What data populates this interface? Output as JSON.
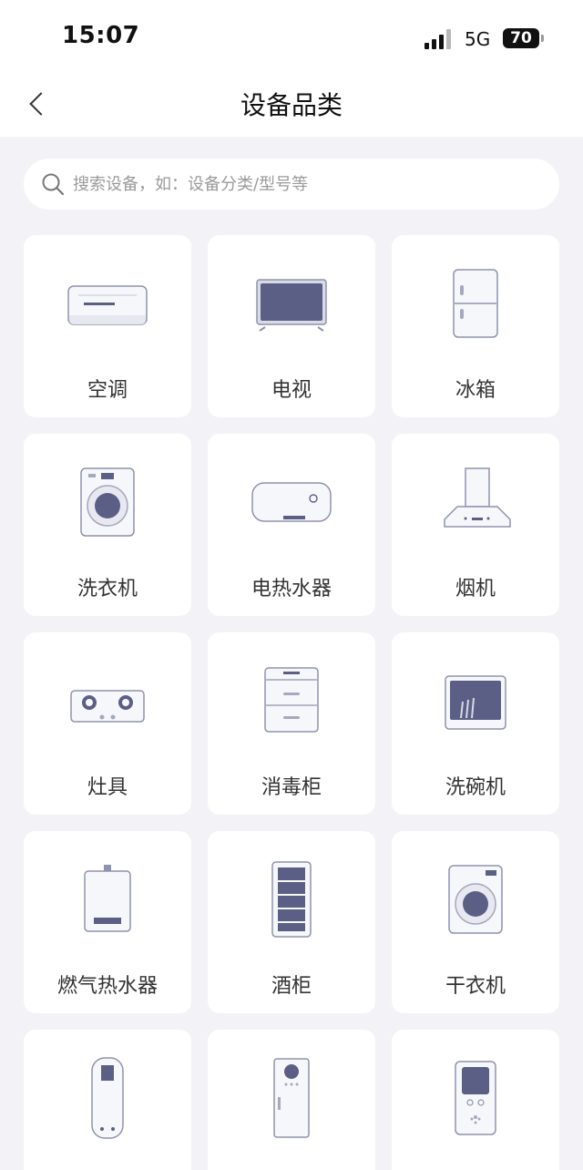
{
  "status_bar": {
    "time": "15:07",
    "network": "5G",
    "battery": "70"
  },
  "header": {
    "title": "设备品类"
  },
  "search": {
    "placeholder": "搜索设备，如：设备分类/型号等"
  },
  "categories": [
    {
      "label": "空调",
      "icon": "air-conditioner-icon"
    },
    {
      "label": "电视",
      "icon": "tv-icon"
    },
    {
      "label": "冰箱",
      "icon": "refrigerator-icon"
    },
    {
      "label": "洗衣机",
      "icon": "washing-machine-icon"
    },
    {
      "label": "电热水器",
      "icon": "electric-water-heater-icon"
    },
    {
      "label": "烟机",
      "icon": "range-hood-icon"
    },
    {
      "label": "灶具",
      "icon": "gas-stove-icon"
    },
    {
      "label": "消毒柜",
      "icon": "disinfection-cabinet-icon"
    },
    {
      "label": "洗碗机",
      "icon": "dishwasher-icon"
    },
    {
      "label": "燃气热水器",
      "icon": "gas-water-heater-icon"
    },
    {
      "label": "酒柜",
      "icon": "wine-cabinet-icon"
    },
    {
      "label": "干衣机",
      "icon": "dryer-icon"
    },
    {
      "label": "",
      "icon": "vertical-water-heater-icon"
    },
    {
      "label": "",
      "icon": "cabinet-appliance-icon"
    },
    {
      "label": "",
      "icon": "air-purifier-icon"
    }
  ],
  "colors": {
    "page_background": "#f3f3f7",
    "card_background": "#ffffff",
    "appliance_accent": "#5b5f86",
    "appliance_body": "#f2f3f8"
  }
}
